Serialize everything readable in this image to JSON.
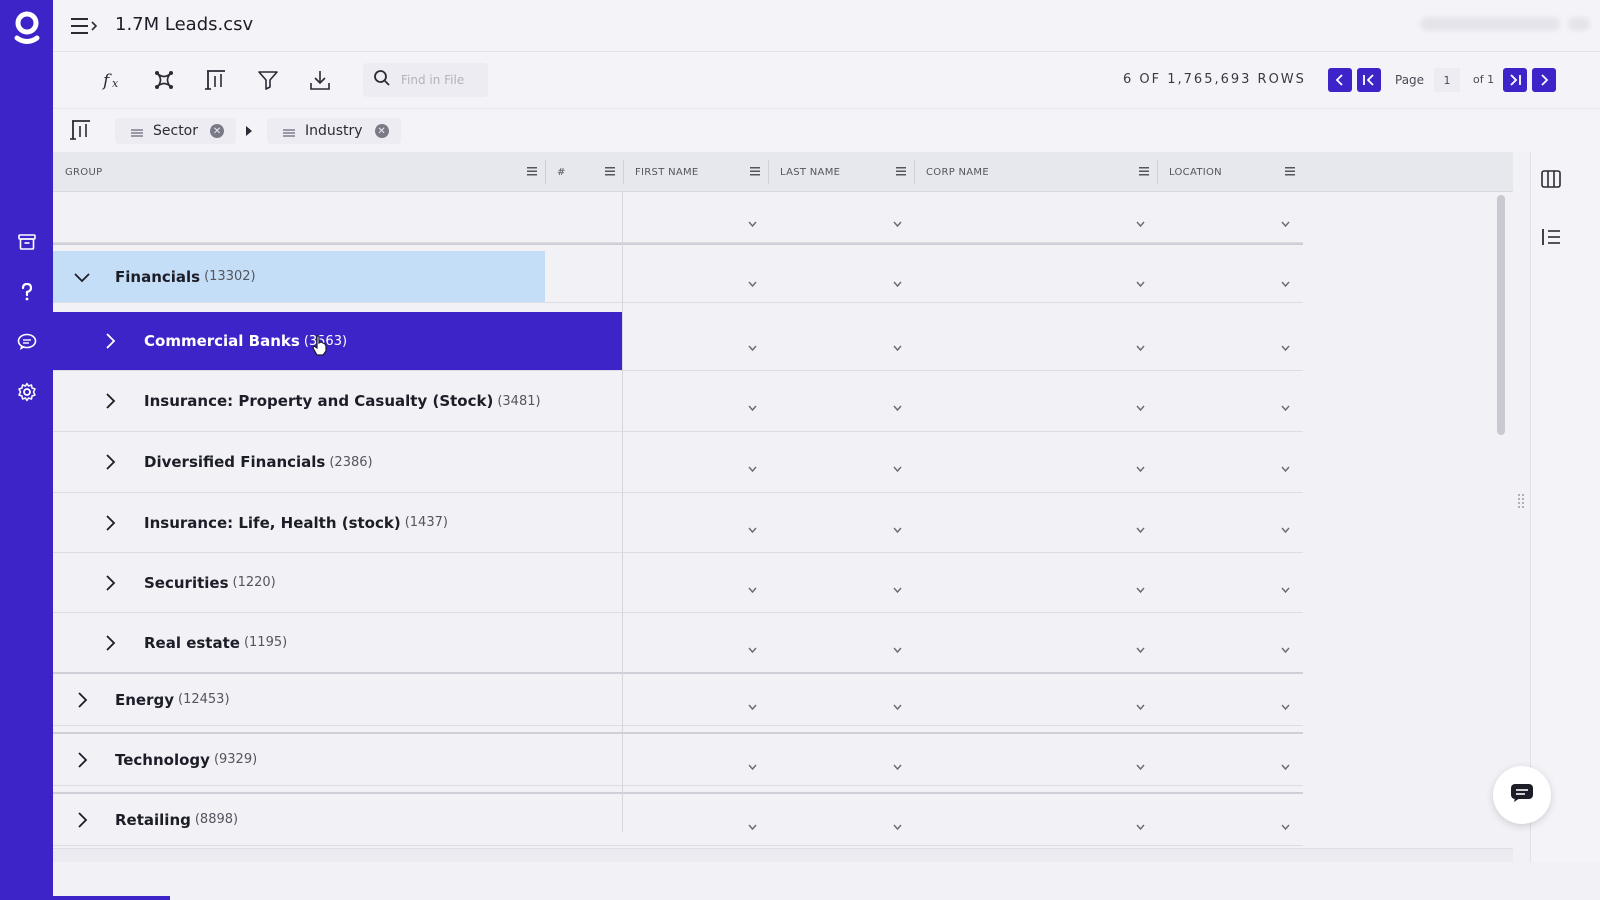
{
  "app": {
    "file_title": "1.7M Leads.csv",
    "accent": "#3d24c9"
  },
  "toolbar": {
    "icons": [
      "formula-icon",
      "pivot-icon",
      "group-icon",
      "filter-icon",
      "download-icon"
    ],
    "search_placeholder": "Find in File",
    "rows_count": "6 OF 1,765,693 ROWS",
    "page_label": "Page",
    "page_value": "1",
    "page_of": "of 1"
  },
  "groupbar": {
    "chips": [
      {
        "label": "Sector"
      },
      {
        "label": "Industry"
      }
    ]
  },
  "grid": {
    "columns": [
      "GROUP",
      "#",
      "FIRST NAME",
      "LAST NAME",
      "CORP NAME",
      "LOCATION"
    ],
    "rows": [
      {
        "label": "Financials",
        "count": "(13302)",
        "level": 0,
        "expanded": true,
        "state": "selected-light"
      },
      {
        "label": "Commercial Banks",
        "count": "(3563)",
        "level": 1,
        "expanded": false,
        "state": "selected"
      },
      {
        "label": "Insurance: Property and Casualty (Stock)",
        "count": "(3481)",
        "level": 1,
        "expanded": false
      },
      {
        "label": "Diversified Financials",
        "count": "(2386)",
        "level": 1,
        "expanded": false
      },
      {
        "label": "Insurance: Life, Health (stock)",
        "count": "(1437)",
        "level": 1,
        "expanded": false
      },
      {
        "label": "Securities",
        "count": "(1220)",
        "level": 1,
        "expanded": false
      },
      {
        "label": "Real estate",
        "count": "(1195)",
        "level": 1,
        "expanded": false
      },
      {
        "label": "Energy",
        "count": "(12453)",
        "level": 0,
        "expanded": false
      },
      {
        "label": "Technology",
        "count": "(9329)",
        "level": 0,
        "expanded": false
      },
      {
        "label": "Retailing",
        "count": "(8898)",
        "level": 0,
        "expanded": false
      }
    ]
  }
}
